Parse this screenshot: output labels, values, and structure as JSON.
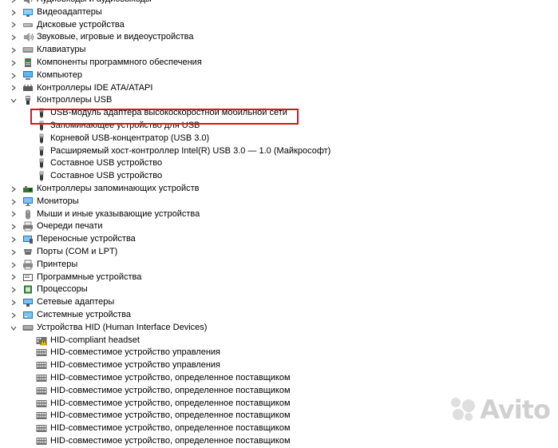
{
  "tree": [
    {
      "label": "Аудиовходы и аудиовыходы",
      "level": 0,
      "expanded": false,
      "icon": "audio-io-icon"
    },
    {
      "label": "Видеоадаптеры",
      "level": 0,
      "expanded": false,
      "icon": "display-adapter-icon"
    },
    {
      "label": "Дисковые устройства",
      "level": 0,
      "expanded": false,
      "icon": "disk-drive-icon"
    },
    {
      "label": "Звуковые, игровые и видеоустройства",
      "level": 0,
      "expanded": false,
      "icon": "speaker-icon"
    },
    {
      "label": "Клавиатуры",
      "level": 0,
      "expanded": false,
      "icon": "keyboard-icon"
    },
    {
      "label": "Компоненты программного обеспечения",
      "level": 0,
      "expanded": false,
      "icon": "software-component-icon"
    },
    {
      "label": "Компьютер",
      "level": 0,
      "expanded": false,
      "icon": "computer-icon"
    },
    {
      "label": "Контроллеры IDE ATA/ATAPI",
      "level": 0,
      "expanded": false,
      "icon": "ide-controller-icon"
    },
    {
      "label": "Контроллеры USB",
      "level": 0,
      "expanded": true,
      "icon": "usb-controller-icon"
    },
    {
      "label": "USB-модуль адаптера высокоскоростной мобильной сети",
      "level": 1,
      "icon": "usb-plug-icon",
      "highlighted": true
    },
    {
      "label": "Запоминающее устройство для USB",
      "level": 1,
      "icon": "usb-plug-icon"
    },
    {
      "label": "Корневой USB-концентратор (USB 3.0)",
      "level": 1,
      "icon": "usb-plug-icon"
    },
    {
      "label": "Расширяемый хост-контроллер Intel(R) USB 3.0 — 1.0 (Майкрософт)",
      "level": 1,
      "icon": "usb-plug-icon"
    },
    {
      "label": "Составное USB устройство",
      "level": 1,
      "icon": "usb-plug-icon"
    },
    {
      "label": "Составное USB устройство",
      "level": 1,
      "icon": "usb-plug-icon"
    },
    {
      "label": "Контроллеры запоминающих устройств",
      "level": 0,
      "expanded": false,
      "icon": "storage-controller-icon"
    },
    {
      "label": "Мониторы",
      "level": 0,
      "expanded": false,
      "icon": "monitor-icon"
    },
    {
      "label": "Мыши и иные указывающие устройства",
      "level": 0,
      "expanded": false,
      "icon": "mouse-icon"
    },
    {
      "label": "Очереди печати",
      "level": 0,
      "expanded": false,
      "icon": "print-queue-icon"
    },
    {
      "label": "Переносные устройства",
      "level": 0,
      "expanded": false,
      "icon": "portable-device-icon"
    },
    {
      "label": "Порты (COM и LPT)",
      "level": 0,
      "expanded": false,
      "icon": "port-icon"
    },
    {
      "label": "Принтеры",
      "level": 0,
      "expanded": false,
      "icon": "printer-icon"
    },
    {
      "label": "Программные устройства",
      "level": 0,
      "expanded": false,
      "icon": "software-device-icon"
    },
    {
      "label": "Процессоры",
      "level": 0,
      "expanded": false,
      "icon": "processor-icon"
    },
    {
      "label": "Сетевые адаптеры",
      "level": 0,
      "expanded": false,
      "icon": "network-adapter-icon"
    },
    {
      "label": "Системные устройства",
      "level": 0,
      "expanded": false,
      "icon": "system-device-icon"
    },
    {
      "label": "Устройства HID (Human Interface Devices)",
      "level": 0,
      "expanded": true,
      "icon": "hid-icon"
    },
    {
      "label": "HID-compliant headset",
      "level": 1,
      "icon": "hid-warning-icon"
    },
    {
      "label": "HID-совместимое устройство управления",
      "level": 1,
      "icon": "hid-device-icon"
    },
    {
      "label": "HID-совместимое устройство управления",
      "level": 1,
      "icon": "hid-device-icon"
    },
    {
      "label": "HID-совместимое устройство, определенное поставщиком",
      "level": 1,
      "icon": "hid-device-icon"
    },
    {
      "label": "HID-совместимое устройство, определенное поставщиком",
      "level": 1,
      "icon": "hid-device-icon"
    },
    {
      "label": "HID-совместимое устройство, определенное поставщиком",
      "level": 1,
      "icon": "hid-device-icon"
    },
    {
      "label": "HID-совместимое устройство, определенное поставщиком",
      "level": 1,
      "icon": "hid-device-icon"
    },
    {
      "label": "HID-совместимое устройство, определенное поставщиком",
      "level": 1,
      "icon": "hid-device-icon"
    },
    {
      "label": "HID-совместимое устройство, определенное поставщиком",
      "level": 1,
      "icon": "hid-device-icon"
    }
  ],
  "watermark": {
    "text": "Avito"
  },
  "colors": {
    "highlight": "#d8151c",
    "text": "#000000",
    "background": "#ffffff"
  }
}
